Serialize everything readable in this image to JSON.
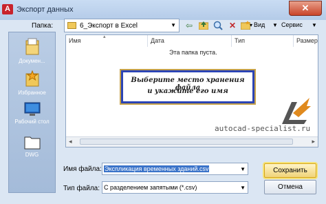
{
  "window": {
    "title": "Экспорт данных",
    "app_icon_label": "A"
  },
  "toolbar": {
    "folder_label": "Папка:",
    "current_folder": "6_Экспорт в Excel",
    "view_label": "Вид",
    "service_label": "Сервис"
  },
  "places": [
    {
      "label": "Докумен...",
      "icon": "documents-icon"
    },
    {
      "label": "Избранное",
      "icon": "favorites-icon"
    },
    {
      "label": "Рабочий стол",
      "icon": "desktop-icon"
    },
    {
      "label": "DWG",
      "icon": "dwg-folder-icon"
    }
  ],
  "file_list": {
    "columns": [
      "Имя",
      "Дата",
      "Тип",
      "Размер"
    ],
    "empty_message": "Эта папка пуста."
  },
  "callout": {
    "line1": "Выберите место хранения файла",
    "line2": "и укажите его имя"
  },
  "watermark": "autocad-specialist.ru",
  "form": {
    "filename_label": "Имя файла:",
    "filename_value": "Экспликация временных зданий.csv",
    "filetype_label": "Тип файла:",
    "filetype_value": "С разделением запятыми (*.csv)",
    "save_label": "Сохранить",
    "cancel_label": "Отмена"
  },
  "colors": {
    "accent_blue": "#2b44b5",
    "close_red": "#c9452a",
    "save_highlight": "#f0d37a"
  }
}
